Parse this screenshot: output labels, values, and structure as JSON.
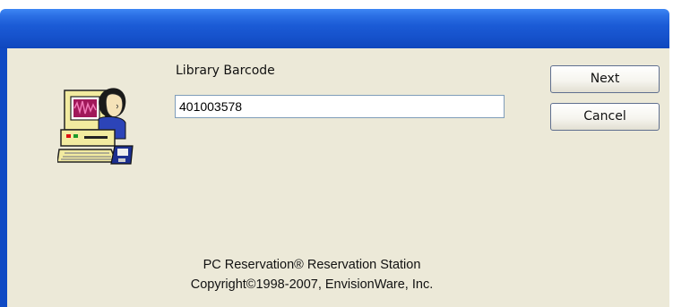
{
  "form": {
    "barcode_label": "Library Barcode",
    "barcode_value": "401003578"
  },
  "buttons": {
    "next_label": "Next",
    "cancel_label": "Cancel"
  },
  "footer": {
    "line1": "PC Reservation® Reservation Station",
    "line2": "Copyright©1998-2007, EnvisionWare, Inc."
  },
  "icons": {
    "app": "user-at-computer-icon"
  },
  "colors": {
    "titlebar": "#1652cc",
    "window_background": "#ece9d8",
    "input_border": "#7f9db9"
  }
}
